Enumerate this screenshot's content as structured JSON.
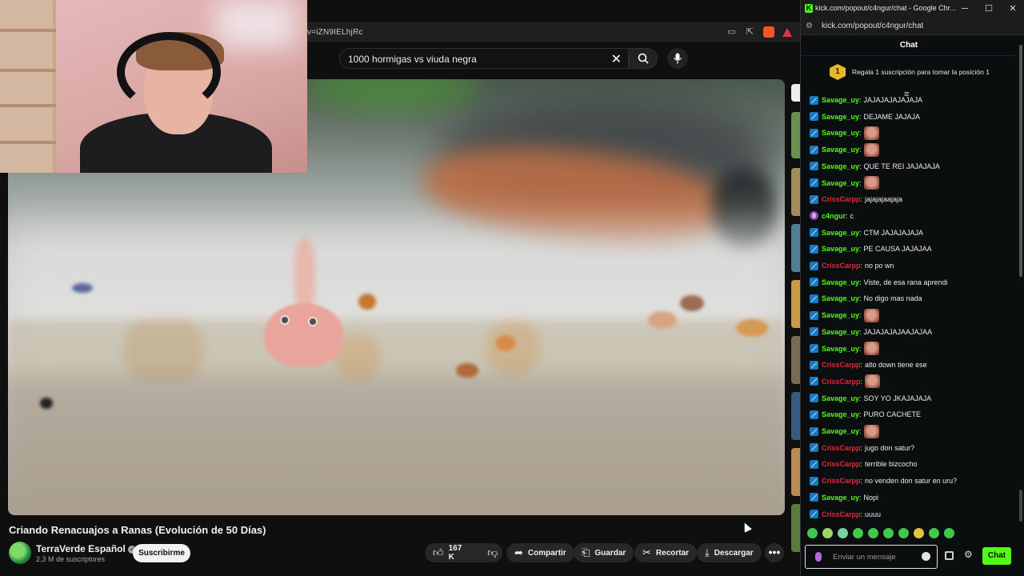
{
  "youtube": {
    "url_fragment": "v=iZN9IELhjRc",
    "search_query": "1000 hormigas vs viuda negra",
    "video_title": "Criando Renacuajos a Ranas (Evolución de 50 Días)",
    "channel_name": "TerraVerde Español",
    "subscribers": "2,3 M de suscriptores",
    "subscribe_label": "Suscribirme",
    "likes": "167 K",
    "share_label": "Compartir",
    "save_label": "Guardar",
    "clip_label": "Recortar",
    "download_label": "Descargar",
    "more_label": "•••"
  },
  "kick": {
    "window_title": "kick.com/popout/c4ngur/chat - Google Chr...",
    "url": "kick.com/popout/c4ngur/chat",
    "header": "Chat",
    "promo_rank": "1",
    "promo_text": "Regala 1 suscripción para tomar la posición 1",
    "input_placeholder": "Enviar un mensaje",
    "send_label": "Chat",
    "colors": {
      "accent": "#53fc18",
      "savage": "#53fc18",
      "criss": "#e3283e",
      "streamer": "#53fc18"
    },
    "messages": [
      {
        "user": "Savage_uy",
        "text": "JAJAJAJAJAJAJA",
        "color": "#53fc18",
        "badge": "sub"
      },
      {
        "user": "Savage_uy",
        "text": "DEJAME JAJAJA",
        "color": "#53fc18",
        "badge": "sub"
      },
      {
        "user": "Savage_uy",
        "text": "",
        "color": "#53fc18",
        "badge": "sub",
        "emote": true
      },
      {
        "user": "Savage_uy",
        "text": "",
        "color": "#53fc18",
        "badge": "sub",
        "emote": true
      },
      {
        "user": "Savage_uy",
        "text": "QUE TE REI JAJAJAJA",
        "color": "#53fc18",
        "badge": "sub"
      },
      {
        "user": "Savage_uy",
        "text": "",
        "color": "#53fc18",
        "badge": "sub",
        "emote": true
      },
      {
        "user": "CrissCarpp",
        "text": "jajajajaajaja",
        "color": "#e3283e",
        "badge": "sub"
      },
      {
        "user": "c4ngur",
        "text": "c",
        "color": "#53fc18",
        "badge": "mic"
      },
      {
        "user": "Savage_uy",
        "text": "CTM JAJAJAJAJA",
        "color": "#53fc18",
        "badge": "sub"
      },
      {
        "user": "Savage_uy",
        "text": "PE CAUSA JAJAJAA",
        "color": "#53fc18",
        "badge": "sub"
      },
      {
        "user": "CrissCarpp",
        "text": "no po wn",
        "color": "#e3283e",
        "badge": "sub"
      },
      {
        "user": "Savage_uy",
        "text": "Viste, de esa rana aprendi",
        "color": "#53fc18",
        "badge": "sub"
      },
      {
        "user": "Savage_uy",
        "text": "No digo mas nada",
        "color": "#53fc18",
        "badge": "sub"
      },
      {
        "user": "Savage_uy",
        "text": "",
        "color": "#53fc18",
        "badge": "sub",
        "emote": true
      },
      {
        "user": "Savage_uy",
        "text": "JAJAJAJAJAAJAJAA",
        "color": "#53fc18",
        "badge": "sub"
      },
      {
        "user": "Savage_uy",
        "text": "",
        "color": "#53fc18",
        "badge": "sub",
        "emote": true
      },
      {
        "user": "CrissCarpp",
        "text": "alto down tiene ese",
        "color": "#e3283e",
        "badge": "sub"
      },
      {
        "user": "CrissCarpp",
        "text": "",
        "color": "#e3283e",
        "badge": "sub",
        "emote": true
      },
      {
        "user": "Savage_uy",
        "text": "SOY YO JKAJAJAJA",
        "color": "#53fc18",
        "badge": "sub"
      },
      {
        "user": "Savage_uy",
        "text": "PURO CACHETE",
        "color": "#53fc18",
        "badge": "sub"
      },
      {
        "user": "Savage_uy",
        "text": "",
        "color": "#53fc18",
        "badge": "sub",
        "emote": true
      },
      {
        "user": "CrissCarpp",
        "text": "jugo don satur?",
        "color": "#e3283e",
        "badge": "sub"
      },
      {
        "user": "CrissCarpp",
        "text": "terrible bizcocho",
        "color": "#e3283e",
        "badge": "sub"
      },
      {
        "user": "CrissCarpp",
        "text": "no venden don satur en uru?",
        "color": "#e3283e",
        "badge": "sub"
      },
      {
        "user": "Savage_uy",
        "text": "Nopi",
        "color": "#53fc18",
        "badge": "sub"
      },
      {
        "user": "CrissCarpp",
        "text": "uuuu",
        "color": "#e3283e",
        "badge": "sub"
      }
    ]
  }
}
